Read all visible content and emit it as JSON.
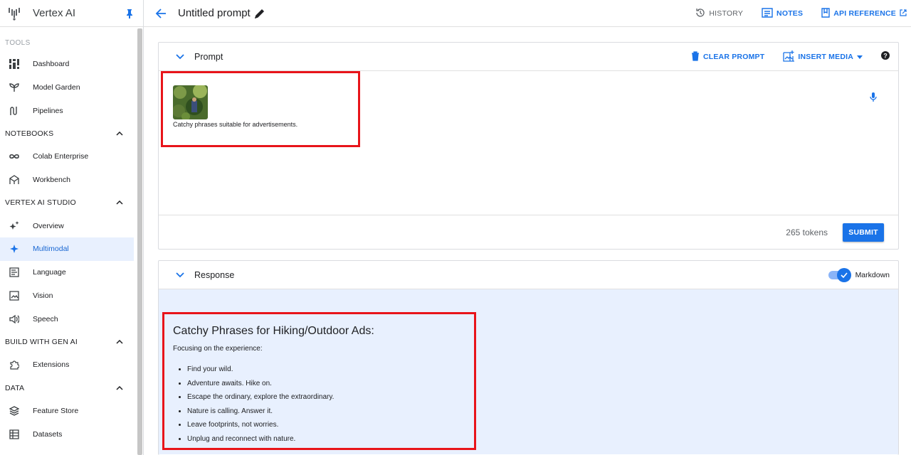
{
  "app": {
    "name": "Vertex AI"
  },
  "sidebar": {
    "tools_label": "TOOLS",
    "tools": [
      {
        "label": "Dashboard",
        "icon": "dashboard-icon"
      },
      {
        "label": "Model Garden",
        "icon": "sprout-icon"
      },
      {
        "label": "Pipelines",
        "icon": "pipelines-icon"
      }
    ],
    "notebooks_label": "NOTEBOOKS",
    "notebooks": [
      {
        "label": "Colab Enterprise",
        "icon": "infinity-icon"
      },
      {
        "label": "Workbench",
        "icon": "workbench-icon"
      }
    ],
    "studio_label": "VERTEX AI STUDIO",
    "studio": [
      {
        "label": "Overview",
        "icon": "sparkles-icon"
      },
      {
        "label": "Multimodal",
        "icon": "sparkle-icon"
      },
      {
        "label": "Language",
        "icon": "language-icon"
      },
      {
        "label": "Vision",
        "icon": "vision-icon"
      },
      {
        "label": "Speech",
        "icon": "speech-icon"
      }
    ],
    "build_label": "BUILD WITH GEN AI",
    "build": [
      {
        "label": "Extensions",
        "icon": "puzzle-icon"
      }
    ],
    "data_label": "DATA",
    "data": [
      {
        "label": "Feature Store",
        "icon": "stack-icon"
      },
      {
        "label": "Datasets",
        "icon": "table-icon"
      }
    ]
  },
  "topbar": {
    "title": "Untitled prompt",
    "history": "HISTORY",
    "notes": "NOTES",
    "api_reference": "API REFERENCE"
  },
  "prompt": {
    "title": "Prompt",
    "clear": "CLEAR PROMPT",
    "insert_media": "INSERT MEDIA",
    "text": "Catchy phrases suitable for advertisements.",
    "tokens": "265 tokens",
    "submit": "SUBMIT"
  },
  "response": {
    "title": "Response",
    "markdown_label": "Markdown",
    "markdown_on": true,
    "heading": "Catchy Phrases for Hiking/Outdoor Ads:",
    "subheading": "Focusing on the experience:",
    "items": [
      "Find your wild.",
      "Adventure awaits. Hike on.",
      "Escape the ordinary, explore the extraordinary.",
      "Nature is calling. Answer it.",
      "Leave footprints, not worries.",
      "Unplug and reconnect with nature."
    ]
  },
  "colors": {
    "accent": "#1a73e8",
    "highlight": "#e8141a",
    "response_bg": "#e8f0fe"
  }
}
